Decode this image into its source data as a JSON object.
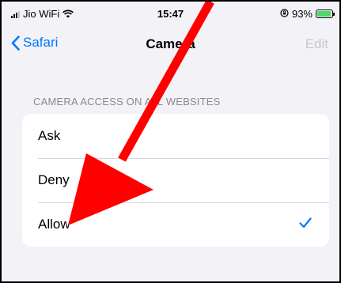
{
  "status_bar": {
    "carrier": "Jio WiFi",
    "time": "15:47",
    "battery_percent": "93%",
    "battery_level": 0.93
  },
  "nav": {
    "back_label": "Safari",
    "title": "Camera",
    "edit_label": "Edit"
  },
  "section": {
    "header": "CAMERA ACCESS ON ALL WEBSITES"
  },
  "options": [
    {
      "label": "Ask",
      "selected": false
    },
    {
      "label": "Deny",
      "selected": false
    },
    {
      "label": "Allow",
      "selected": true
    }
  ],
  "colors": {
    "accent": "#007aff",
    "annotation_arrow": "#ff0000",
    "battery_charging": "#4cd964"
  }
}
